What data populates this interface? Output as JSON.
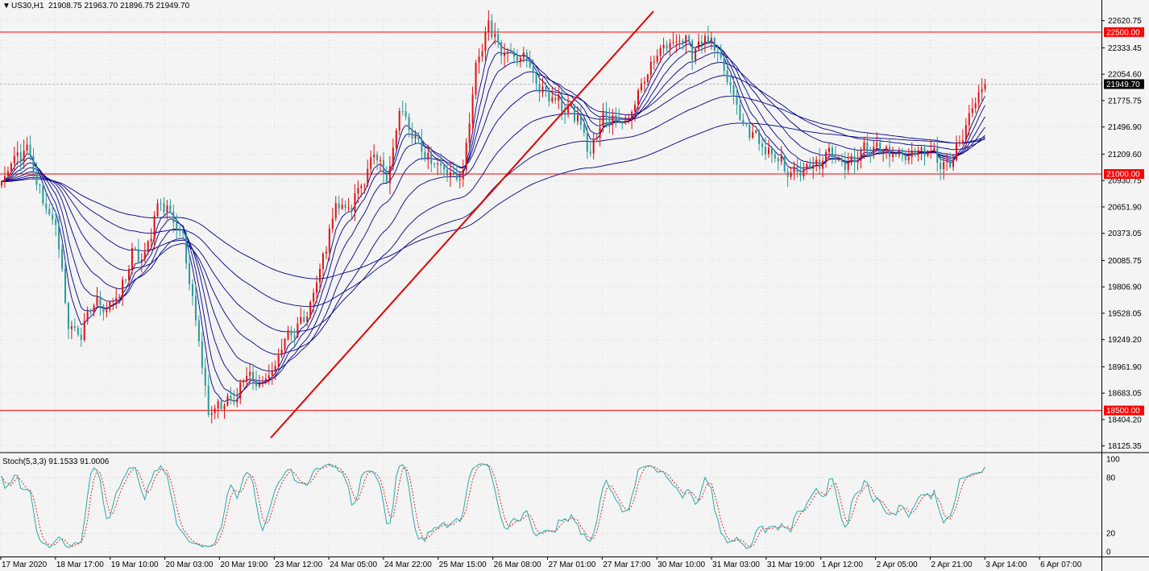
{
  "header": {
    "symbol_timeframe": "US30,H1",
    "ohlc": "21908.75 21963.70 21896.75 21949.70"
  },
  "indicator": {
    "label": "Stoch(5,3,3) 91.1533 91.0006"
  },
  "colors": {
    "background": "#f4f4f4",
    "grid": "#c8c8c8",
    "bull_candle": "#e01010",
    "bear_candle": "#2a9a9a",
    "ma_ribbon": "#00008b",
    "support_resistance": "#ff0000",
    "trendline": "#e00000",
    "stoch_main": "#2aa8a8",
    "stoch_signal": "#e01010",
    "current_price_tag_bg": "#000000"
  },
  "chart_data": [
    {
      "type": "candlestick",
      "title": "US30,H1",
      "price_axis_ticks": [
        22620.75,
        22333.45,
        22054.6,
        21775.75,
        21496.9,
        21209.6,
        20930.75,
        20651.9,
        20373.05,
        20085.75,
        19806.9,
        19528.05,
        19249.2,
        18961.9,
        18683.05,
        18404.2,
        18125.35
      ],
      "ylim": [
        18080,
        22720
      ],
      "x_tick_labels": [
        "17 Mar 2020",
        "18 Mar 17:00",
        "19 Mar 10:00",
        "20 Mar 03:00",
        "20 Mar 19:00",
        "23 Mar 12:00",
        "24 Mar 05:00",
        "24 Mar 22:00",
        "25 Mar 15:00",
        "26 Mar 08:00",
        "27 Mar 01:00",
        "27 Mar 17:00",
        "30 Mar 10:00",
        "31 Mar 03:00",
        "31 Mar 19:00",
        "1 Apr 12:00",
        "2 Apr 05:00",
        "2 Apr 21:00",
        "3 Apr 14:00",
        "6 Apr 07:00"
      ],
      "horizontal_levels": [
        {
          "label": "22500.00",
          "value": 22500.0
        },
        {
          "label": "21000.00",
          "value": 21000.0
        },
        {
          "label": "18500.00",
          "value": 18500.0
        }
      ],
      "current_price": {
        "label": "21949.70",
        "value": 21949.7
      },
      "trendline": {
        "from": {
          "time": "23 Mar 12:00",
          "value": 18210
        },
        "to": {
          "time": "27 Mar 12:00",
          "value": 22720
        }
      },
      "price_path": [
        [
          0,
          20900
        ],
        [
          4,
          21150
        ],
        [
          8,
          21250
        ],
        [
          12,
          20800
        ],
        [
          17,
          20450
        ],
        [
          21,
          19400
        ],
        [
          25,
          19300
        ],
        [
          29,
          19650
        ],
        [
          33,
          19600
        ],
        [
          37,
          19700
        ],
        [
          41,
          20150
        ],
        [
          45,
          20100
        ],
        [
          49,
          20700
        ],
        [
          53,
          20600
        ],
        [
          57,
          20300
        ],
        [
          61,
          19500
        ],
        [
          65,
          18500
        ],
        [
          69,
          18550
        ],
        [
          73,
          18600
        ],
        [
          77,
          18900
        ],
        [
          81,
          18750
        ],
        [
          85,
          18900
        ],
        [
          89,
          19250
        ],
        [
          93,
          19350
        ],
        [
          97,
          19600
        ],
        [
          101,
          20100
        ],
        [
          105,
          20700
        ],
        [
          109,
          20600
        ],
        [
          113,
          20900
        ],
        [
          117,
          21200
        ],
        [
          121,
          20900
        ],
        [
          125,
          21700
        ],
        [
          129,
          21400
        ],
        [
          133,
          21200
        ],
        [
          137,
          21100
        ],
        [
          141,
          21000
        ],
        [
          145,
          21000
        ],
        [
          149,
          22100
        ],
        [
          153,
          22600
        ],
        [
          157,
          22300
        ],
        [
          161,
          22300
        ],
        [
          165,
          22200
        ],
        [
          169,
          21900
        ],
        [
          173,
          21800
        ],
        [
          177,
          21700
        ],
        [
          181,
          21600
        ],
        [
          185,
          21200
        ],
        [
          189,
          21600
        ],
        [
          193,
          21600
        ],
        [
          197,
          21550
        ],
        [
          201,
          21950
        ],
        [
          205,
          22200
        ],
        [
          209,
          22350
        ],
        [
          213,
          22450
        ],
        [
          217,
          22300
        ],
        [
          221,
          22450
        ],
        [
          225,
          22250
        ],
        [
          229,
          21900
        ],
        [
          233,
          21500
        ],
        [
          237,
          21400
        ],
        [
          241,
          21200
        ],
        [
          245,
          21100
        ],
        [
          249,
          21000
        ],
        [
          253,
          21050
        ],
        [
          257,
          21100
        ],
        [
          261,
          21250
        ],
        [
          265,
          21100
        ],
        [
          269,
          21200
        ],
        [
          273,
          21300
        ],
        [
          277,
          21250
        ],
        [
          281,
          21200
        ],
        [
          285,
          21200
        ],
        [
          289,
          21250
        ],
        [
          293,
          21200
        ],
        [
          297,
          21050
        ],
        [
          301,
          21300
        ],
        [
          305,
          21700
        ],
        [
          309,
          21949.7
        ]
      ],
      "ma_periods": [
        5,
        8,
        13,
        21,
        34,
        55,
        89,
        144
      ]
    },
    {
      "type": "line",
      "title": "Stoch(5,3,3) 91.1533 91.0006",
      "ylim": [
        -5,
        105
      ],
      "y_ticks": [
        100,
        80,
        20,
        0
      ],
      "series": [
        {
          "name": "main",
          "values": [],
          "last": 91.1533
        },
        {
          "name": "signal",
          "values": [],
          "last": 91.0006
        }
      ]
    }
  ]
}
